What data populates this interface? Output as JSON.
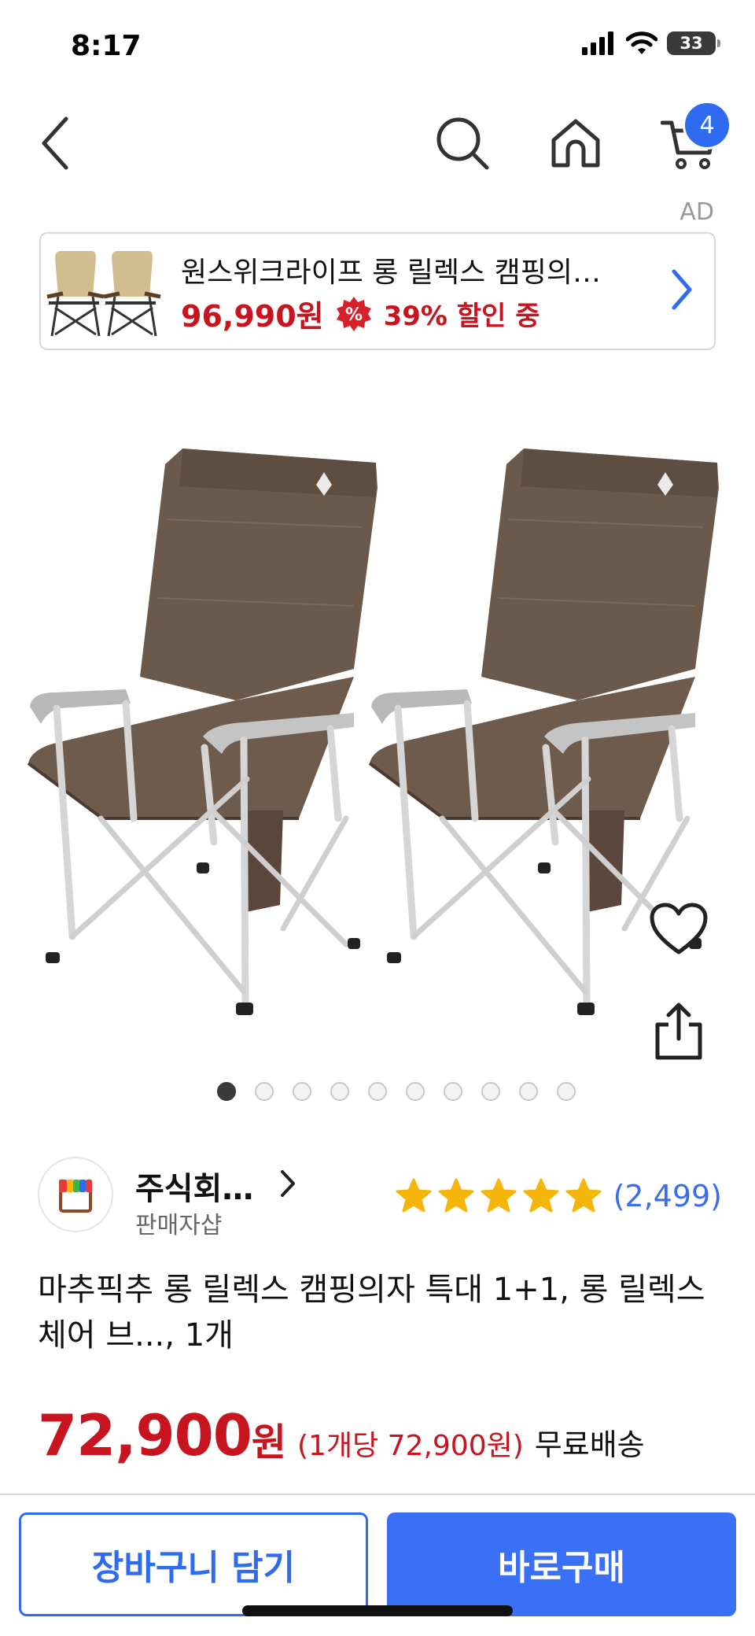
{
  "status_bar": {
    "time": "8:17",
    "battery": "33"
  },
  "nav": {
    "cart_count": "4"
  },
  "ad": {
    "label": "AD",
    "title": "원스위크라이프 롱 릴렉스 캠핑의…",
    "price": "96,990원",
    "discount_icon": "%",
    "discount": "39% 할인 중"
  },
  "gallery": {
    "total_images": 10,
    "current_index": 1
  },
  "seller": {
    "name": "주식회…",
    "sub": "판매자샵"
  },
  "rating": {
    "stars": 5,
    "review_count": "(2,499)"
  },
  "product": {
    "title": "마추픽추 롱 릴렉스 캠핑의자 특대 1+1, 롱 릴렉스 체어 브..., 1개",
    "price": "72,900",
    "price_unit": "원",
    "unit_price": "(1개당 72,900원)",
    "shipping": "무료배송"
  },
  "actions": {
    "cart_label": "장바구니 담기",
    "buy_label": "바로구매"
  },
  "colors": {
    "accent_blue": "#3a70f5",
    "price_red": "#c8141e",
    "star_gold": "#f5b50a"
  }
}
